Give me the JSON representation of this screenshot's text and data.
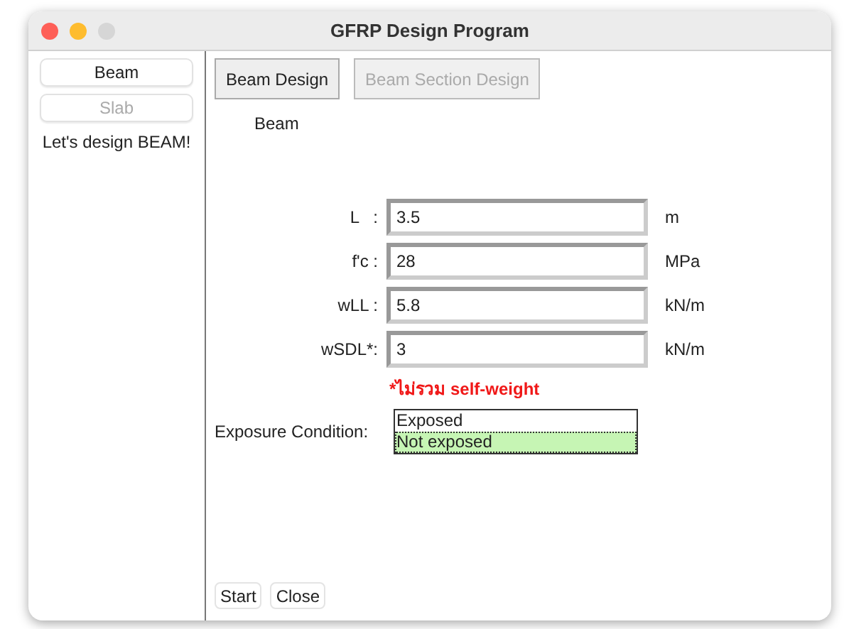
{
  "window": {
    "title": "GFRP Design Program"
  },
  "sidebar": {
    "buttons": [
      {
        "label": "Beam",
        "disabled": false
      },
      {
        "label": "Slab",
        "disabled": true
      }
    ],
    "message": "Let's design BEAM!"
  },
  "tabs": [
    {
      "label": "Beam Design",
      "selected": true
    },
    {
      "label": "Beam Section Design",
      "selected": false
    }
  ],
  "section_label": "Beam",
  "fields": [
    {
      "label": "L   :",
      "value": "3.5",
      "unit": "m"
    },
    {
      "label": "f'c :",
      "value": "28",
      "unit": "MPa"
    },
    {
      "label": "wLL :",
      "value": "5.8",
      "unit": "kN/m"
    },
    {
      "label": "wSDL*:",
      "value": "3",
      "unit": "kN/m"
    }
  ],
  "note": "*ไม่รวม self-weight",
  "exposure": {
    "label": "Exposure Condition:",
    "options": [
      {
        "label": "Exposed",
        "selected": false
      },
      {
        "label": "Not exposed",
        "selected": true
      }
    ]
  },
  "buttons": [
    "Start",
    "Close"
  ]
}
